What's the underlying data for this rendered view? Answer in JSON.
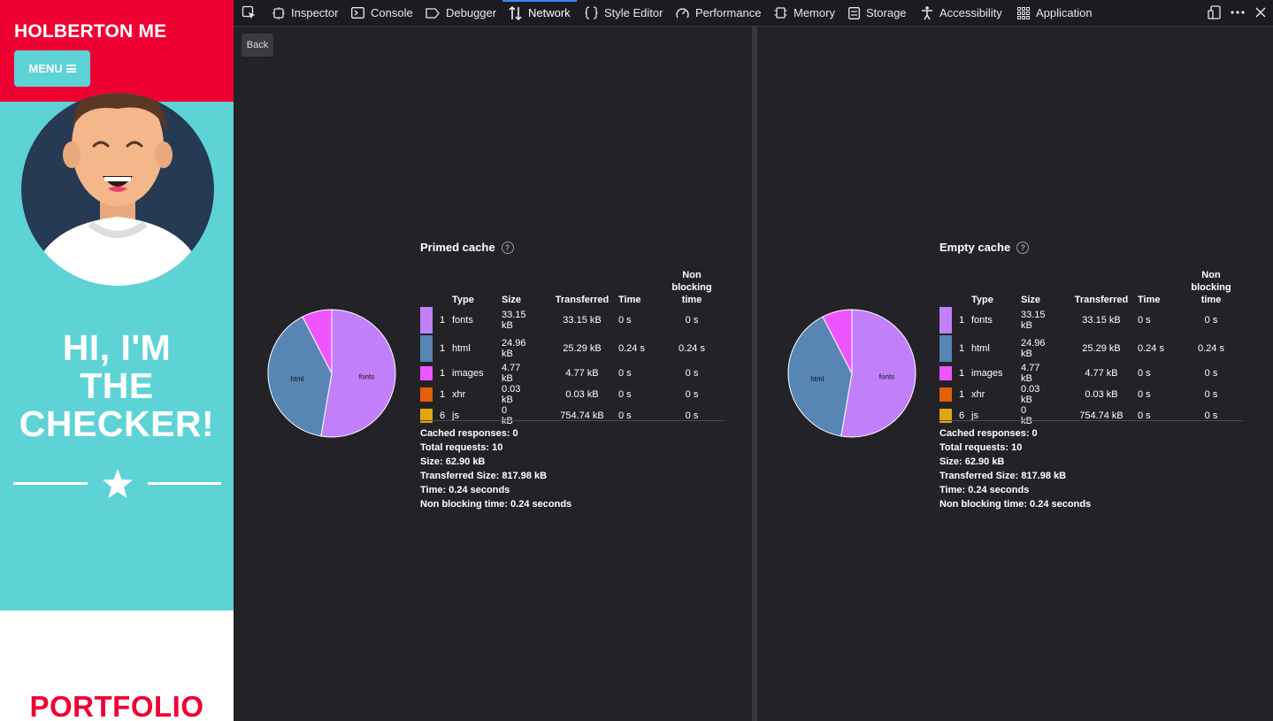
{
  "site": {
    "brand": "HOLBERTON ME",
    "menu_label": "MENU",
    "hero_lines": [
      "HI, I'M",
      "THE",
      "CHECKER!"
    ],
    "portfolio": "PORTFOLIO",
    "colors": {
      "header": "#ef0033",
      "teal": "#5dd3d6"
    }
  },
  "toolbar": {
    "tabs": [
      {
        "label": "Inspector",
        "icon": "inspector-icon"
      },
      {
        "label": "Console",
        "icon": "console-icon"
      },
      {
        "label": "Debugger",
        "icon": "debugger-icon"
      },
      {
        "label": "Network",
        "icon": "network-icon",
        "active": true
      },
      {
        "label": "Style Editor",
        "icon": "style-editor-icon"
      },
      {
        "label": "Performance",
        "icon": "performance-icon"
      },
      {
        "label": "Memory",
        "icon": "memory-icon"
      },
      {
        "label": "Storage",
        "icon": "storage-icon"
      },
      {
        "label": "Accessibility",
        "icon": "accessibility-icon"
      },
      {
        "label": "Application",
        "icon": "application-icon"
      }
    ]
  },
  "back_label": "Back",
  "headers": {
    "type": "Type",
    "size": "Size",
    "transferred": "Transferred",
    "time": "Time",
    "nonblocking": [
      "Non",
      "blocking",
      "time"
    ]
  },
  "panels": [
    {
      "title": "Primed cache",
      "help": "?",
      "rows": [
        {
          "count": "1",
          "type": "fonts",
          "size": "33.15 kB",
          "transferred": "33.15 kB",
          "time": "0 s",
          "nonblocking": "0 s",
          "color": "#c17ffa"
        },
        {
          "count": "1",
          "type": "html",
          "size": "24.96 kB",
          "transferred": "25.29 kB",
          "time": "0.24 s",
          "nonblocking": "0.24 s",
          "color": "#5785b4"
        },
        {
          "count": "1",
          "type": "images",
          "size": "4.77 kB",
          "transferred": "4.77 kB",
          "time": "0 s",
          "nonblocking": "0 s",
          "color": "#ee55ff"
        },
        {
          "count": "1",
          "type": "xhr",
          "size": "0.03 kB",
          "transferred": "0.03 kB",
          "time": "0 s",
          "nonblocking": "0 s",
          "color": "#e4600b"
        },
        {
          "count": "6",
          "type": "js",
          "size": "0 kB",
          "transferred": "754.74 kB",
          "time": "0 s",
          "nonblocking": "0 s",
          "color": "#e0a60f"
        }
      ],
      "summary": [
        "Cached responses: 0",
        "Total requests: 10",
        "Size: 62.90 kB",
        "Transferred Size: 817.98 kB",
        "Time: 0.24 seconds",
        "Non blocking time: 0.24 seconds"
      ]
    },
    {
      "title": "Empty cache",
      "help": "?",
      "rows": [
        {
          "count": "1",
          "type": "fonts",
          "size": "33.15 kB",
          "transferred": "33.15 kB",
          "time": "0 s",
          "nonblocking": "0 s",
          "color": "#c17ffa"
        },
        {
          "count": "1",
          "type": "html",
          "size": "24.96 kB",
          "transferred": "25.29 kB",
          "time": "0.24 s",
          "nonblocking": "0.24 s",
          "color": "#5785b4"
        },
        {
          "count": "1",
          "type": "images",
          "size": "4.77 kB",
          "transferred": "4.77 kB",
          "time": "0 s",
          "nonblocking": "0 s",
          "color": "#ee55ff"
        },
        {
          "count": "1",
          "type": "xhr",
          "size": "0.03 kB",
          "transferred": "0.03 kB",
          "time": "0 s",
          "nonblocking": "0 s",
          "color": "#e4600b"
        },
        {
          "count": "6",
          "type": "js",
          "size": "0 kB",
          "transferred": "754.74 kB",
          "time": "0 s",
          "nonblocking": "0 s",
          "color": "#e0a60f"
        }
      ],
      "summary": [
        "Cached responses: 0",
        "Total requests: 10",
        "Size: 62.90 kB",
        "Transferred Size: 817.98 kB",
        "Time: 0.24 seconds",
        "Non blocking time: 0.24 seconds"
      ]
    }
  ],
  "chart_data": [
    {
      "type": "pie",
      "title": "Primed cache",
      "categories": [
        "fonts",
        "html",
        "images"
      ],
      "values": [
        33.15,
        24.96,
        4.77
      ],
      "colors": [
        "#c17ffa",
        "#5785b4",
        "#ee55ff"
      ]
    },
    {
      "type": "pie",
      "title": "Empty cache",
      "categories": [
        "fonts",
        "html",
        "images"
      ],
      "values": [
        33.15,
        24.96,
        4.77
      ],
      "colors": [
        "#c17ffa",
        "#5785b4",
        "#ee55ff"
      ]
    }
  ]
}
